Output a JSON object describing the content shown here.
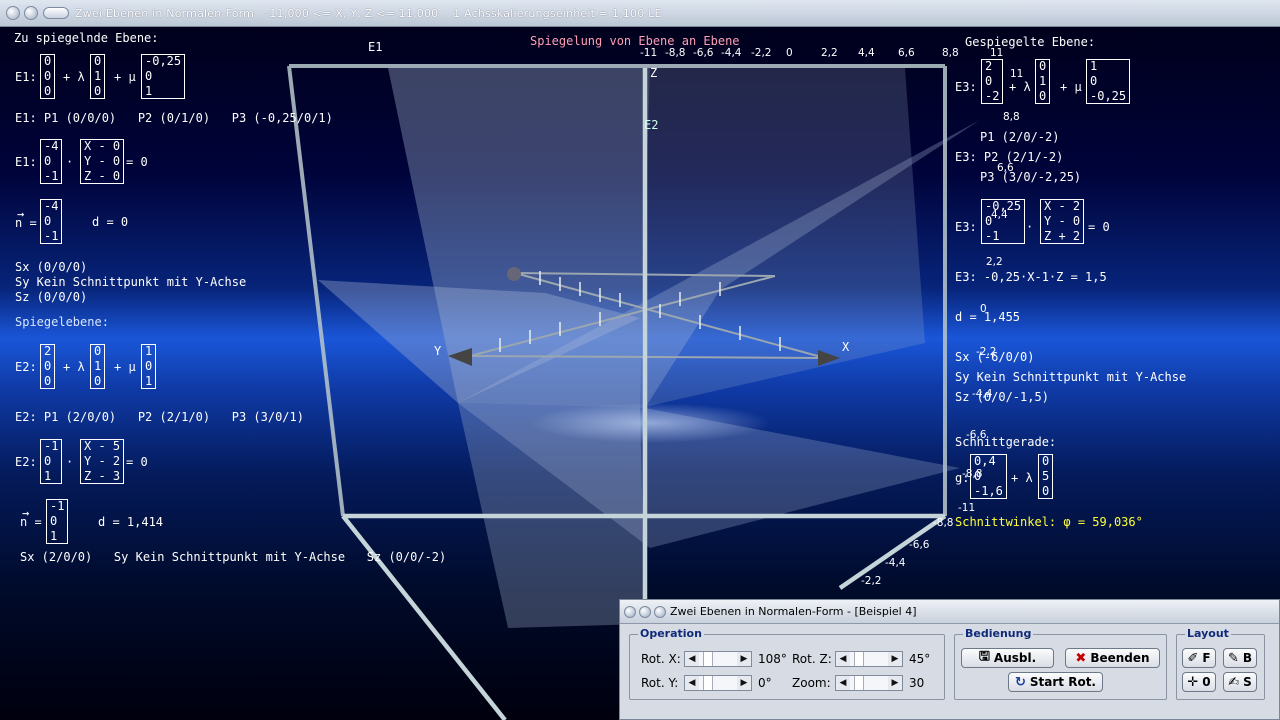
{
  "window": {
    "title": "Zwei Ebenen in Normalen-Form   -11,000 <= X, Y, Z <= 11,000    1 Achsskalierungseinheit = 1,100 LE"
  },
  "scene": {
    "heading": "Spiegelung von Ebene an Ebene",
    "label_e1": "E1",
    "label_e2": "E2",
    "axis_x": "X",
    "axis_y": "Y",
    "axis_z": "Z",
    "top_ticks": [
      "-11",
      "-8,8",
      "-6,6",
      "-4,4",
      "-2,2",
      "0",
      "2,2",
      "4,4",
      "6,6",
      "8,8",
      "11"
    ],
    "right_ticks": [
      "11",
      "8,8",
      "6,6",
      "4,4",
      "2,2",
      "0",
      "-2,2",
      "-4,4",
      "-6,6",
      "-8,8",
      "-11"
    ],
    "bottom_ticks": [
      "-8,8",
      "-6,6",
      "-4,4",
      "-2,2"
    ]
  },
  "left": {
    "head1": "Zu spiegelnde Ebene:",
    "e1_label": "E1:",
    "e1_p": [
      "0",
      "0",
      "0"
    ],
    "e1_u": [
      "0",
      "1",
      "0"
    ],
    "e1_v": [
      "-0,25",
      "0",
      "1"
    ],
    "plus_lambda": "+ λ",
    "plus_mu": "+ μ",
    "e1_points": "E1: P1 (0/0/0)   P2 (0/1/0)   P3 (-0,25/0/1)",
    "e1_n": [
      "-4",
      "0",
      "-1"
    ],
    "e1_xv": [
      "X - 0",
      "Y - 0",
      "Z - 0"
    ],
    "dot": "·",
    "eq_zero": "= 0",
    "n_label": "n =",
    "n_arrow": "→",
    "e1_d": "d = 0",
    "e1_sx": "Sx (0/0/0)",
    "e1_sy": "Sy Kein Schnittpunkt mit Y-Achse",
    "e1_sz": "Sz (0/0/0)",
    "head2": "Spiegelebene:",
    "e2_label": "E2:",
    "e2_p": [
      "2",
      "0",
      "0"
    ],
    "e2_u": [
      "0",
      "1",
      "0"
    ],
    "e2_v": [
      "1",
      "0",
      "1"
    ],
    "e2_points": "E2: P1 (2/0/0)   P2 (2/1/0)   P3 (3/0/1)",
    "e2_n": [
      "-1",
      "0",
      "1"
    ],
    "e2_xv": [
      "X - 5",
      "Y - 2",
      "Z - 3"
    ],
    "e2_nn": [
      "-1",
      "0",
      "1"
    ],
    "e2_d": "d = 1,414",
    "e2_s": "Sx (2/0/0)   Sy Kein Schnittpunkt mit Y-Achse   Sz (0/0/-2)"
  },
  "right": {
    "head": "Gespiegelte Ebene:",
    "e3_label": "E3:",
    "e3_p": [
      "2",
      "0",
      "-2"
    ],
    "e3_u": [
      "0",
      "1",
      "0"
    ],
    "e3_v": [
      "1",
      "0",
      "-0,25"
    ],
    "p1": "P1 (2/0/-2)",
    "p2": "E3: P2 (2/1/-2)",
    "p3": "P3 (3/0/-2,25)",
    "e3_n": [
      "-0,25",
      "0",
      "-1"
    ],
    "e3_xv": [
      "X - 2",
      "Y - 0",
      "Z + 2"
    ],
    "e3_coord": "E3: -0,25·X-1·Z = 1,5",
    "e3_d": "d = 1,455",
    "sx": "Sx (-6/0/0)",
    "sy": "Sy Kein Schnittpunkt mit Y-Achse",
    "sz": "Sz (0/0/-1,5)",
    "sg_head": "Schnittgerade:",
    "g_label": "g:",
    "g_p": [
      "0,4",
      "0",
      "-1,6"
    ],
    "g_u": [
      "0",
      "5",
      "0"
    ],
    "angle": "Schnittwinkel: φ = 59,036°"
  },
  "dialog": {
    "title": "Zwei Ebenen in Normalen-Form - [Beispiel 4]",
    "group_operation": "Operation",
    "group_bedienung": "Bedienung",
    "group_layout": "Layout",
    "rot_x_label": "Rot. X:",
    "rot_x_value": "108°",
    "rot_y_label": "Rot. Y:",
    "rot_y_value": "0°",
    "rot_z_label": "Rot. Z:",
    "rot_z_value": "45°",
    "zoom_label": "Zoom:",
    "zoom_value": "30",
    "btn_ausbl": "Ausbl.",
    "btn_beenden": "Beenden",
    "btn_start_rot": "Start Rot.",
    "btn_f": "F",
    "btn_b": "B",
    "btn_0": "0",
    "btn_s": "S"
  }
}
